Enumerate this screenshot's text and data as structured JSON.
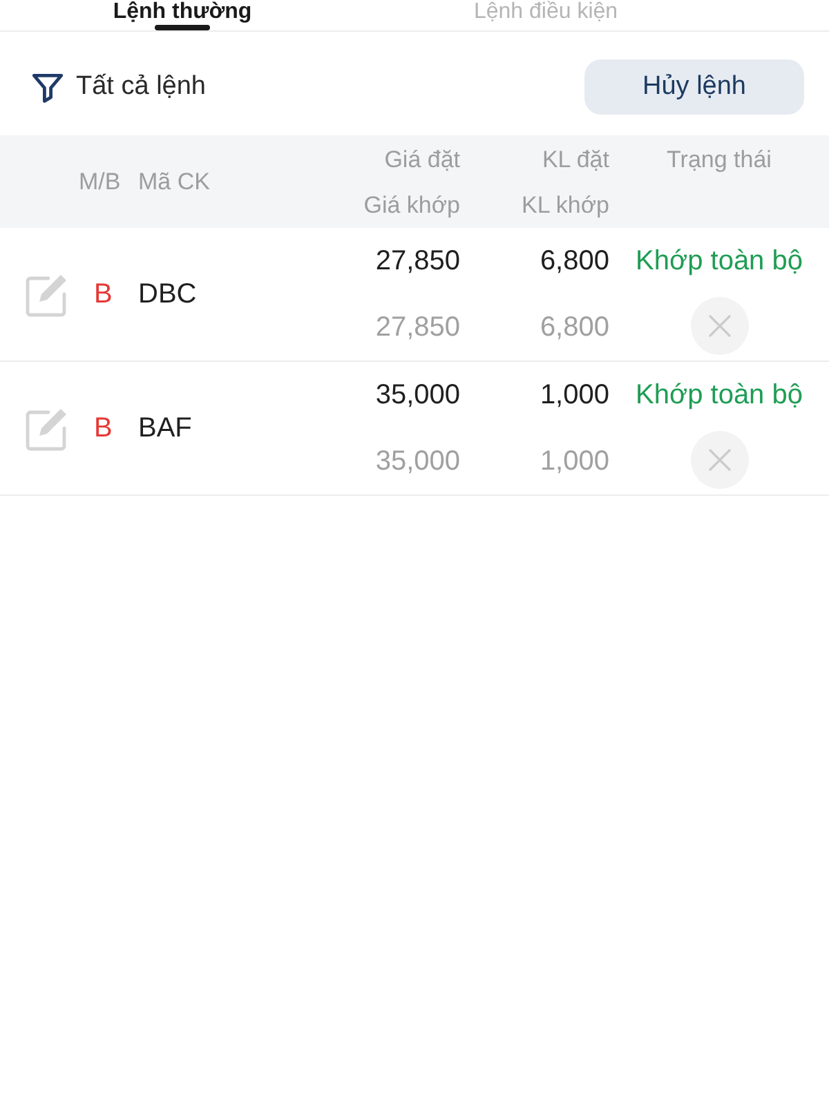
{
  "tabs": [
    {
      "label": "Lệnh thường",
      "selected": true
    },
    {
      "label": "Lệnh điều kiện",
      "selected": false
    }
  ],
  "toolbar": {
    "filter_label": "Tất cả lệnh",
    "cancel_button": "Hủy lệnh"
  },
  "table": {
    "columns": {
      "side": "M/B",
      "symbol": "Mã CK",
      "order_price": "Giá đặt",
      "match_price": "Giá khớp",
      "order_qty": "KL đặt",
      "match_qty": "KL khớp",
      "status": "Trạng thái"
    },
    "rows": [
      {
        "side": {
          "label": "B",
          "color": "#e53935"
        },
        "symbol": "DBC",
        "order_price": "27,850",
        "order_qty": "6,800",
        "match_price": "27,850",
        "match_qty": "6,800",
        "status": {
          "label": "Khớp toàn bộ",
          "color": "#1f9d55"
        },
        "disabled": true
      },
      {
        "side": {
          "label": "B",
          "color": "#e53935"
        },
        "symbol": "BAF",
        "order_price": "35,000",
        "order_qty": "1,000",
        "match_price": "35,000",
        "match_qty": "1,000",
        "status": {
          "label": "Khớp toàn bộ",
          "color": "#1f9d55"
        },
        "disabled": true
      }
    ]
  }
}
